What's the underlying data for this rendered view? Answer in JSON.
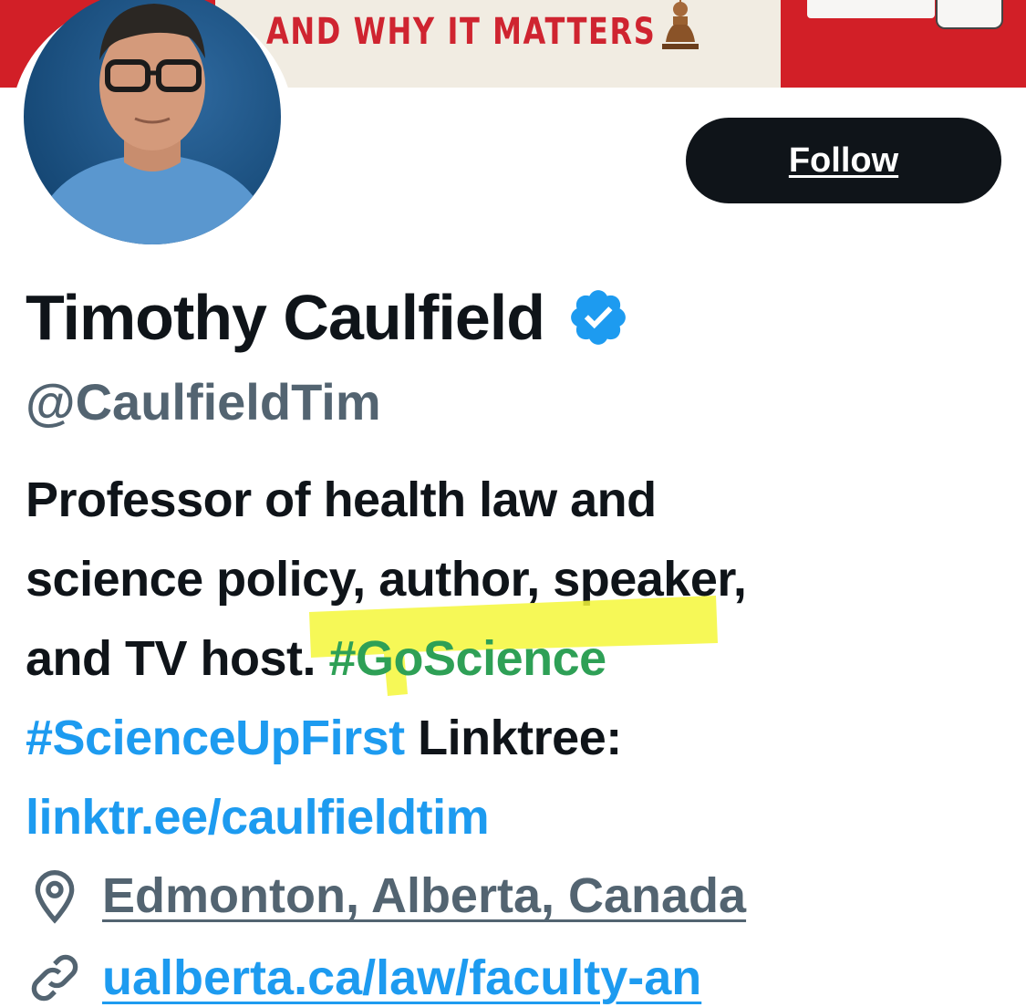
{
  "banner": {
    "headline": "AND WHY IT MATTERS"
  },
  "profile": {
    "follow_label": "Follow",
    "display_name": "Timothy Caulfield",
    "handle": "@CaulfieldTim",
    "bio": {
      "line1": "Professor of health law and",
      "line2": "science policy, author, speaker,",
      "line3_prefix": "and TV host. ",
      "hashtag1": "#GoScience",
      "hashtag2": "#ScienceUpFirst",
      "linktree_label": " Linktree:",
      "link": "linktr.ee/caulfieldtim"
    },
    "location": "Edmonton, Alberta, Canada",
    "website": "ualberta.ca/law/faculty-an"
  },
  "icons": {
    "verified": "verified-badge-icon",
    "location": "location-pin-icon",
    "website": "link-icon"
  },
  "colors": {
    "accent": "#1d9bf0",
    "text": "#0f1419",
    "secondary": "#536471",
    "highlighter": "#f4f73a",
    "banner_red": "#d21f27"
  }
}
